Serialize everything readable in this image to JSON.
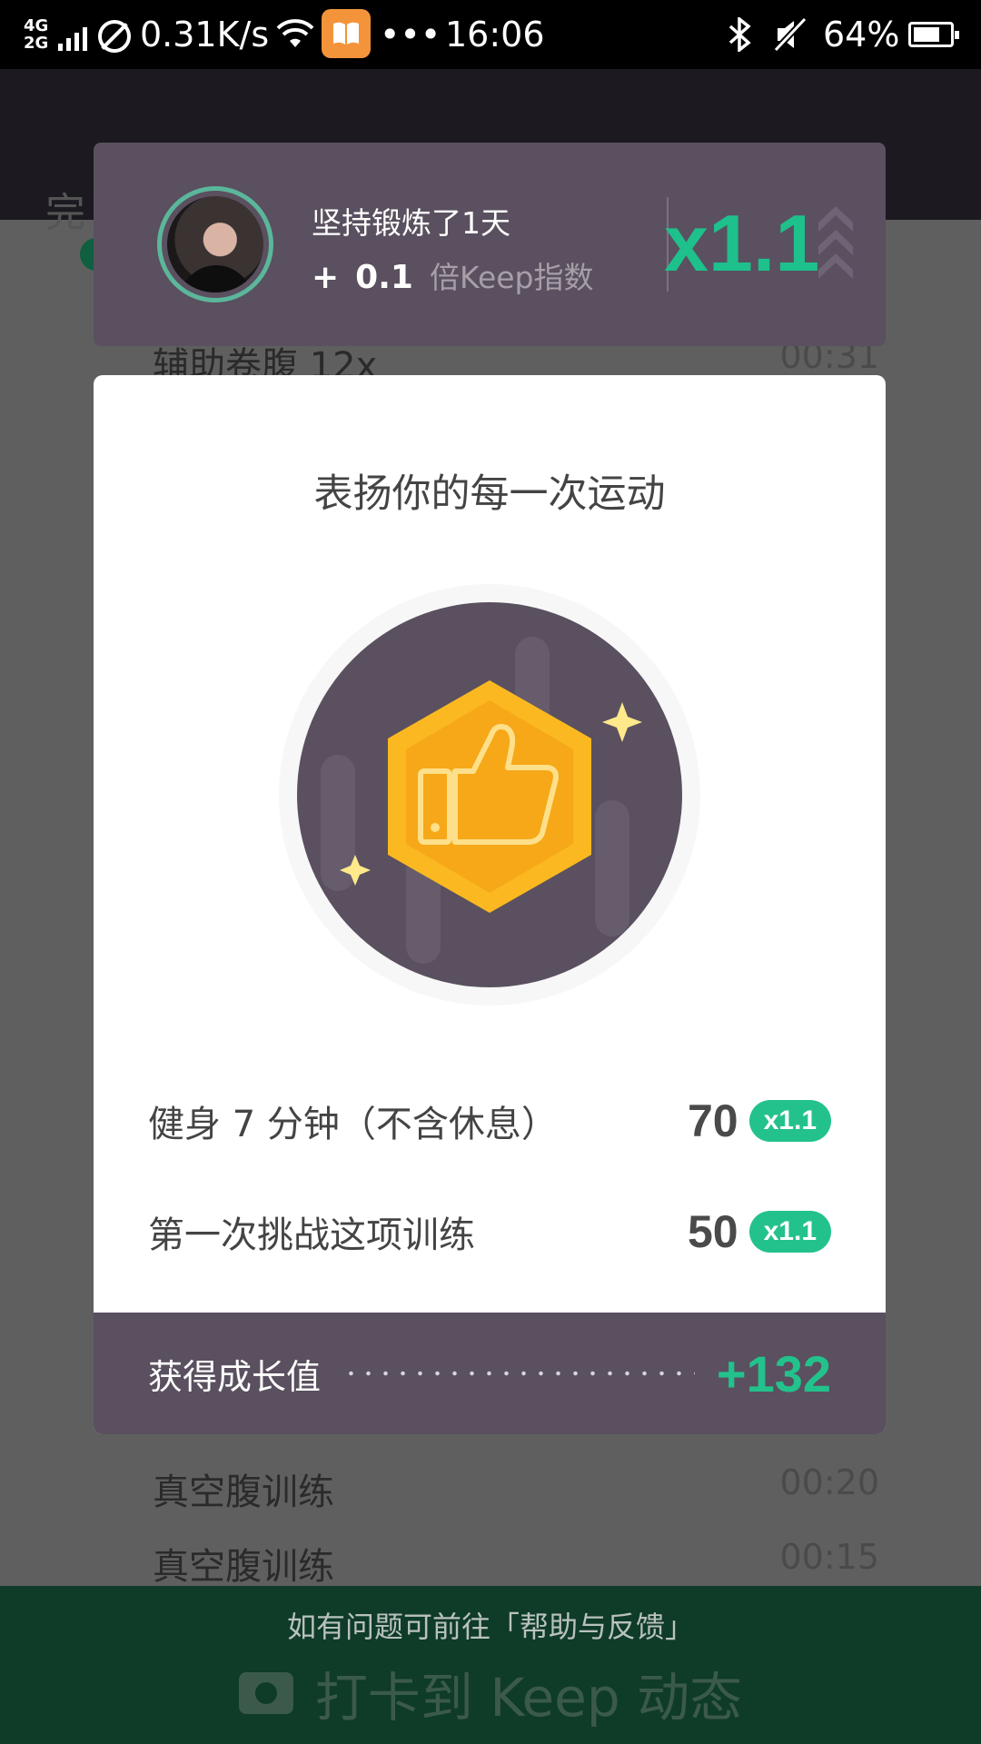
{
  "status_bar": {
    "network_top": "4G",
    "network_bottom": "2G",
    "speed": "0.31K/s",
    "time": "16:06",
    "battery": "64%",
    "icons": [
      "signal-icon",
      "no-sim-icon",
      "wifi-icon",
      "book-app-icon",
      "more-dots-icon",
      "bluetooth-icon",
      "mute-icon",
      "battery-icon"
    ]
  },
  "background": {
    "title": "完",
    "rows": [
      {
        "name": "辅助卷腹 12x",
        "time": "00:31"
      },
      {
        "name": "真空腹训练",
        "time": "00:20"
      },
      {
        "name": "真空腹训练",
        "time": "00:15"
      }
    ],
    "help_text": "如有问题可前往「帮助与反馈」",
    "checkin_label": "打卡到 Keep 动态"
  },
  "streak_card": {
    "streak_text": "坚持锻炼了1天",
    "plus": "+",
    "bonus_value": "0.1",
    "bonus_unit": "倍Keep指数",
    "multiplier": "x1.1"
  },
  "modal": {
    "title": "表扬你的每一次运动",
    "badge_icon": "thumbs-up-icon",
    "items": [
      {
        "label": "健身 7 分钟（不含休息）",
        "points": "70",
        "multiplier": "x1.1"
      },
      {
        "label": "第一次挑战这项训练",
        "points": "50",
        "multiplier": "x1.1"
      }
    ],
    "summary_label": "获得成长值",
    "summary_total": "+132"
  },
  "colors": {
    "accent_green": "#23c28c",
    "card_purple": "#5a505f",
    "badge_gold": "#fbb820"
  }
}
